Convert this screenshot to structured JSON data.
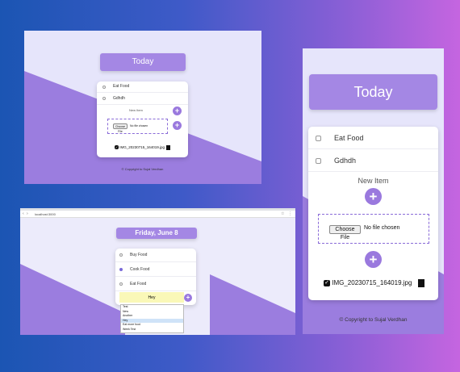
{
  "panel1": {
    "today_label": "Today",
    "items": [
      "Eat Food",
      "Gdhdh"
    ],
    "new_item_label": "New Item",
    "choose_file_label": "Choose File",
    "no_file_label": "No file chosen",
    "image_name": "IMG_20230715_164019.jpg",
    "copyright": "© Copyright to Sujal Verdhan"
  },
  "panel2": {
    "today_label": "Today",
    "items": [
      "Eat Food",
      "Gdhdh"
    ],
    "new_item_label": "New Item",
    "choose_file_label": "Choose File",
    "no_file_label": "No file chosen",
    "image_name": "IMG_20230715_164019.jpg",
    "copyright": "© Copyright to Sujal Verdhan"
  },
  "panel3": {
    "url": "localhost:3000",
    "date_label": "Friday, June 8",
    "items": [
      {
        "label": "Buy Food",
        "checked": false
      },
      {
        "label": "Cook Food",
        "checked": true
      },
      {
        "label": "Eat Food",
        "checked": false
      }
    ],
    "input_value": "Hey",
    "autocomplete": [
      "Test",
      "New",
      "Another",
      "Hey",
      "Eat more food",
      "Week Test"
    ],
    "autocomplete_selected": "Hey"
  },
  "colors": {
    "accent": "#a487e4",
    "purple_bg": "#9b7ddf",
    "light_bg": "#e6e5fb"
  }
}
